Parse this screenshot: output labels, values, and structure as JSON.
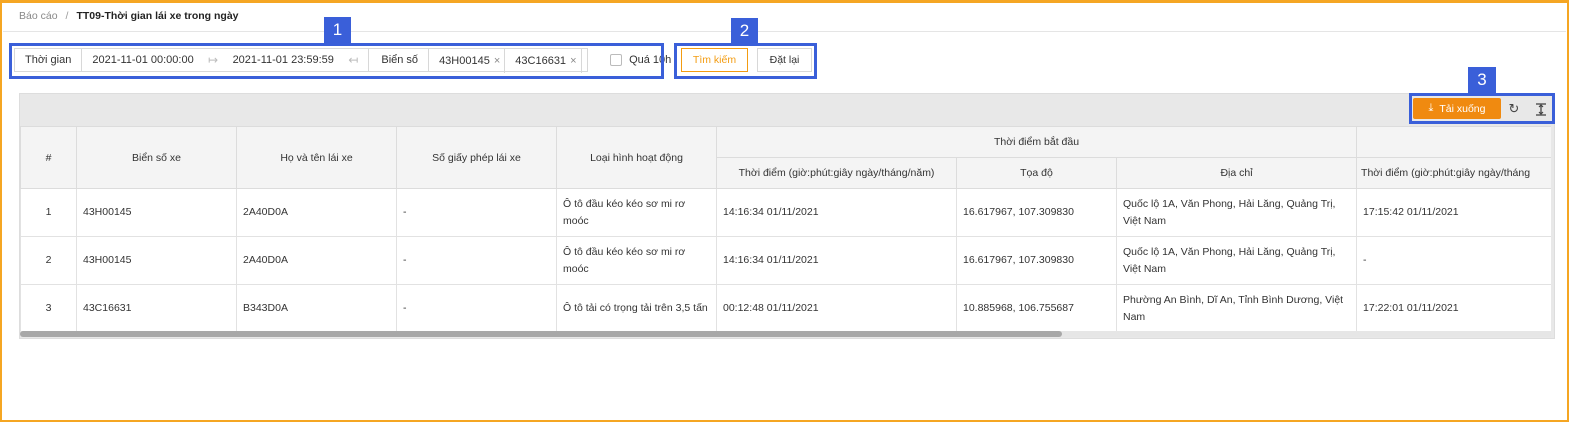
{
  "breadcrumb": {
    "root": "Báo cáo",
    "separator": "/",
    "current": "TT09-Thời gian lái xe trong ngày"
  },
  "filters": {
    "time_label": "Thời gian",
    "start_datetime": "2021-11-01 00:00:00",
    "end_datetime": "2021-11-01 23:59:59",
    "plate_label": "Biển số",
    "plate_tags": [
      "43H00145",
      "43C16631"
    ],
    "over10h_label": "Quá 10h",
    "over10h_checked": false
  },
  "actions": {
    "search_label": "Tìm kiếm",
    "reset_label": "Đặt lại",
    "download_label": "Tải xuống"
  },
  "callouts": [
    "1",
    "2",
    "3"
  ],
  "table": {
    "headers": {
      "index": "#",
      "plate": "Biển số xe",
      "driver": "Họ và tên lái xe",
      "license": "Số giấy phép lái xe",
      "vehicle_type": "Loại hình hoạt động",
      "start_group": "Thời điểm bắt đầu",
      "start_time": "Thời điểm (giờ:phút:giây ngày/tháng/năm)",
      "start_coords": "Tọa độ",
      "start_address": "Địa chỉ",
      "end_time": "Thời điểm (giờ:phút:giây ngày/tháng"
    },
    "rows": [
      {
        "index": "1",
        "plate": "43H00145",
        "driver": "2A40D0A",
        "license": "-",
        "vehicle_type": "Ô tô đầu kéo kéo sơ mi rơ moóc",
        "start_time": "14:16:34 01/11/2021",
        "start_coords": "16.617967, 107.309830",
        "start_address": "Quốc lộ 1A, Văn Phong, Hải Lăng, Quảng Trị, Việt Nam",
        "end_time": "17:15:42 01/11/2021"
      },
      {
        "index": "2",
        "plate": "43H00145",
        "driver": "2A40D0A",
        "license": "-",
        "vehicle_type": "Ô tô đầu kéo kéo sơ mi rơ moóc",
        "start_time": "14:16:34 01/11/2021",
        "start_coords": "16.617967, 107.309830",
        "start_address": "Quốc lộ 1A, Văn Phong, Hải Lăng, Quảng Trị, Việt Nam",
        "end_time": "-"
      },
      {
        "index": "3",
        "plate": "43C16631",
        "driver": "B343D0A",
        "license": "-",
        "vehicle_type": "Ô tô tải có trọng tải trên 3,5 tấn",
        "start_time": "00:12:48 01/11/2021",
        "start_coords": "10.885968, 106.755687",
        "start_address": "Phường An Bình, Dĩ An, Tỉnh Bình Dương, Việt Nam",
        "end_time": "17:22:01 01/11/2021"
      }
    ]
  },
  "colors": {
    "accent": "#f08a10",
    "callout": "#3a5fd9",
    "frame": "#f5a623"
  },
  "icons": [
    "arrow-right-to-bar-icon",
    "arrow-left-to-bar-icon",
    "close-icon",
    "download-icon",
    "refresh-icon",
    "column-height-icon"
  ]
}
